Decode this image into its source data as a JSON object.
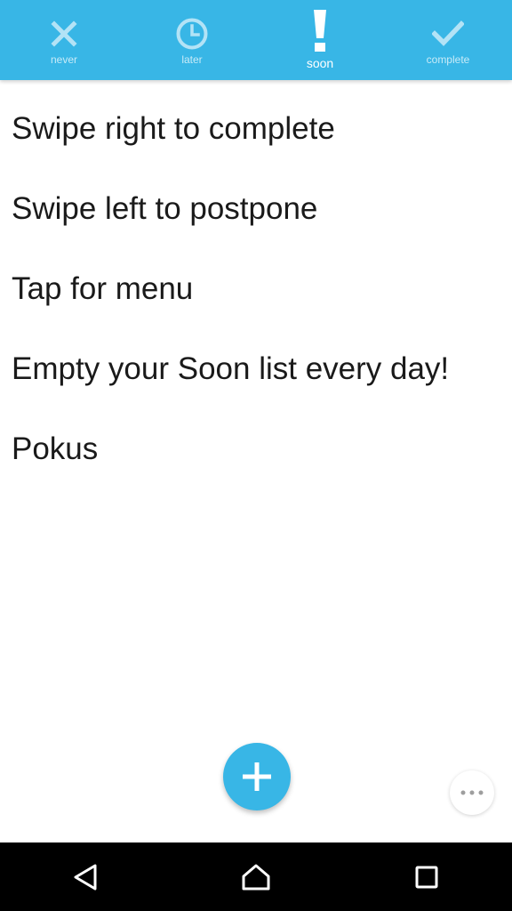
{
  "tabs": [
    {
      "id": "never",
      "label": "never",
      "icon": "close-icon",
      "active": false
    },
    {
      "id": "later",
      "label": "later",
      "icon": "clock-icon",
      "active": false
    },
    {
      "id": "soon",
      "label": "soon",
      "icon": "exclamation-icon",
      "active": true
    },
    {
      "id": "complete",
      "label": "complete",
      "icon": "checkmark-icon",
      "active": false
    }
  ],
  "tasks": [
    "Swipe right to complete",
    "Swipe left to postpone",
    "Tap for menu",
    "Empty your Soon list every day!",
    "Pokus"
  ],
  "fab": {
    "icon": "plus-icon"
  },
  "more": {
    "icon": "more-dots-icon"
  },
  "navbar": {
    "back_icon": "back-triangle-icon",
    "home_icon": "home-icon",
    "recents_icon": "recents-square-icon"
  },
  "colors": {
    "accent": "#38b6e6",
    "inactive_icon": "#b3e3f6",
    "text": "#1a1a1a",
    "navbar": "#000000"
  }
}
